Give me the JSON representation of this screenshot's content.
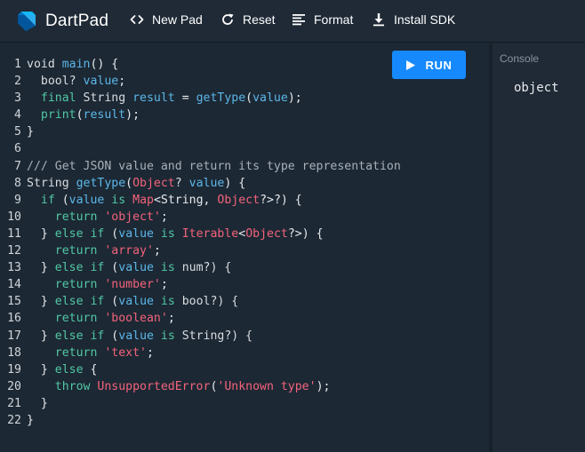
{
  "app": {
    "name": "DartPad"
  },
  "toolbar": {
    "new_pad": "New Pad",
    "reset": "Reset",
    "format": "Format",
    "install_sdk": "Install SDK"
  },
  "run_button": {
    "label": "RUN"
  },
  "console": {
    "label": "Console",
    "output": "object"
  },
  "colors": {
    "accent": "#168afd",
    "keyword": "#52c7a4",
    "identifier": "#5cb7e8",
    "string": "#f3637b",
    "comment": "#a8b0b8",
    "background": "#1c2834"
  },
  "icons": {
    "logo": "dart-logo-icon",
    "new_pad": "code-brackets-icon",
    "reset": "refresh-icon",
    "format": "format-lines-icon",
    "install_sdk": "download-icon",
    "run": "play-icon"
  },
  "code": {
    "line_numbers": [
      "1",
      "2",
      "3",
      "4",
      "5",
      "6",
      "7",
      "8",
      "9",
      "10",
      "11",
      "12",
      "13",
      "14",
      "15",
      "16",
      "17",
      "18",
      "19",
      "20",
      "21",
      "22"
    ],
    "lines": [
      [
        [
          "k",
          "void "
        ],
        [
          "fn",
          "main"
        ],
        [
          "p",
          "() {"
        ]
      ],
      [
        [
          "k",
          "  bool? "
        ],
        [
          "v",
          "value"
        ],
        [
          "p",
          ";"
        ]
      ],
      [
        [
          "kw",
          "  final "
        ],
        [
          "k",
          "String "
        ],
        [
          "v",
          "result"
        ],
        [
          "p",
          " = "
        ],
        [
          "fn",
          "getType"
        ],
        [
          "p",
          "("
        ],
        [
          "v",
          "value"
        ],
        [
          "p",
          ");"
        ]
      ],
      [
        [
          "kw",
          "  print"
        ],
        [
          "p",
          "("
        ],
        [
          "v",
          "result"
        ],
        [
          "p",
          ");"
        ]
      ],
      [
        [
          "p",
          "}"
        ]
      ],
      [
        [
          "p",
          ""
        ]
      ],
      [
        [
          "cm",
          "/// Get JSON value and return its type representation"
        ]
      ],
      [
        [
          "k",
          "String "
        ],
        [
          "fn",
          "getType"
        ],
        [
          "p",
          "("
        ],
        [
          "ty",
          "Object"
        ],
        [
          "k",
          "? "
        ],
        [
          "v",
          "value"
        ],
        [
          "p",
          ") {"
        ]
      ],
      [
        [
          "kw",
          "  if "
        ],
        [
          "p",
          "("
        ],
        [
          "v",
          "value"
        ],
        [
          "kw",
          " is "
        ],
        [
          "ty",
          "Map"
        ],
        [
          "p",
          "<String, "
        ],
        [
          "ty",
          "Object"
        ],
        [
          "p",
          "?>?) {"
        ]
      ],
      [
        [
          "kw",
          "    return "
        ],
        [
          "st",
          "'object'"
        ],
        [
          "p",
          ";"
        ]
      ],
      [
        [
          "p",
          "  } "
        ],
        [
          "kw",
          "else if "
        ],
        [
          "p",
          "("
        ],
        [
          "v",
          "value"
        ],
        [
          "kw",
          " is "
        ],
        [
          "ty",
          "Iterable"
        ],
        [
          "p",
          "<"
        ],
        [
          "ty",
          "Object"
        ],
        [
          "p",
          "?>) {"
        ]
      ],
      [
        [
          "kw",
          "    return "
        ],
        [
          "st",
          "'array'"
        ],
        [
          "p",
          ";"
        ]
      ],
      [
        [
          "p",
          "  } "
        ],
        [
          "kw",
          "else if "
        ],
        [
          "p",
          "("
        ],
        [
          "v",
          "value"
        ],
        [
          "kw",
          " is "
        ],
        [
          "k",
          "num?) {"
        ]
      ],
      [
        [
          "kw",
          "    return "
        ],
        [
          "st",
          "'number'"
        ],
        [
          "p",
          ";"
        ]
      ],
      [
        [
          "p",
          "  } "
        ],
        [
          "kw",
          "else if "
        ],
        [
          "p",
          "("
        ],
        [
          "v",
          "value"
        ],
        [
          "kw",
          " is "
        ],
        [
          "k",
          "bool?) {"
        ]
      ],
      [
        [
          "kw",
          "    return "
        ],
        [
          "st",
          "'boolean'"
        ],
        [
          "p",
          ";"
        ]
      ],
      [
        [
          "p",
          "  } "
        ],
        [
          "kw",
          "else if "
        ],
        [
          "p",
          "("
        ],
        [
          "v",
          "value"
        ],
        [
          "kw",
          " is "
        ],
        [
          "k",
          "String?) {"
        ]
      ],
      [
        [
          "kw",
          "    return "
        ],
        [
          "st",
          "'text'"
        ],
        [
          "p",
          ";"
        ]
      ],
      [
        [
          "p",
          "  } "
        ],
        [
          "kw",
          "else "
        ],
        [
          "p",
          "{"
        ]
      ],
      [
        [
          "kw",
          "    throw "
        ],
        [
          "ty",
          "UnsupportedError"
        ],
        [
          "p",
          "("
        ],
        [
          "st",
          "'Unknown type'"
        ],
        [
          "p",
          ");"
        ]
      ],
      [
        [
          "p",
          "  }"
        ]
      ],
      [
        [
          "p",
          "}"
        ]
      ]
    ]
  }
}
